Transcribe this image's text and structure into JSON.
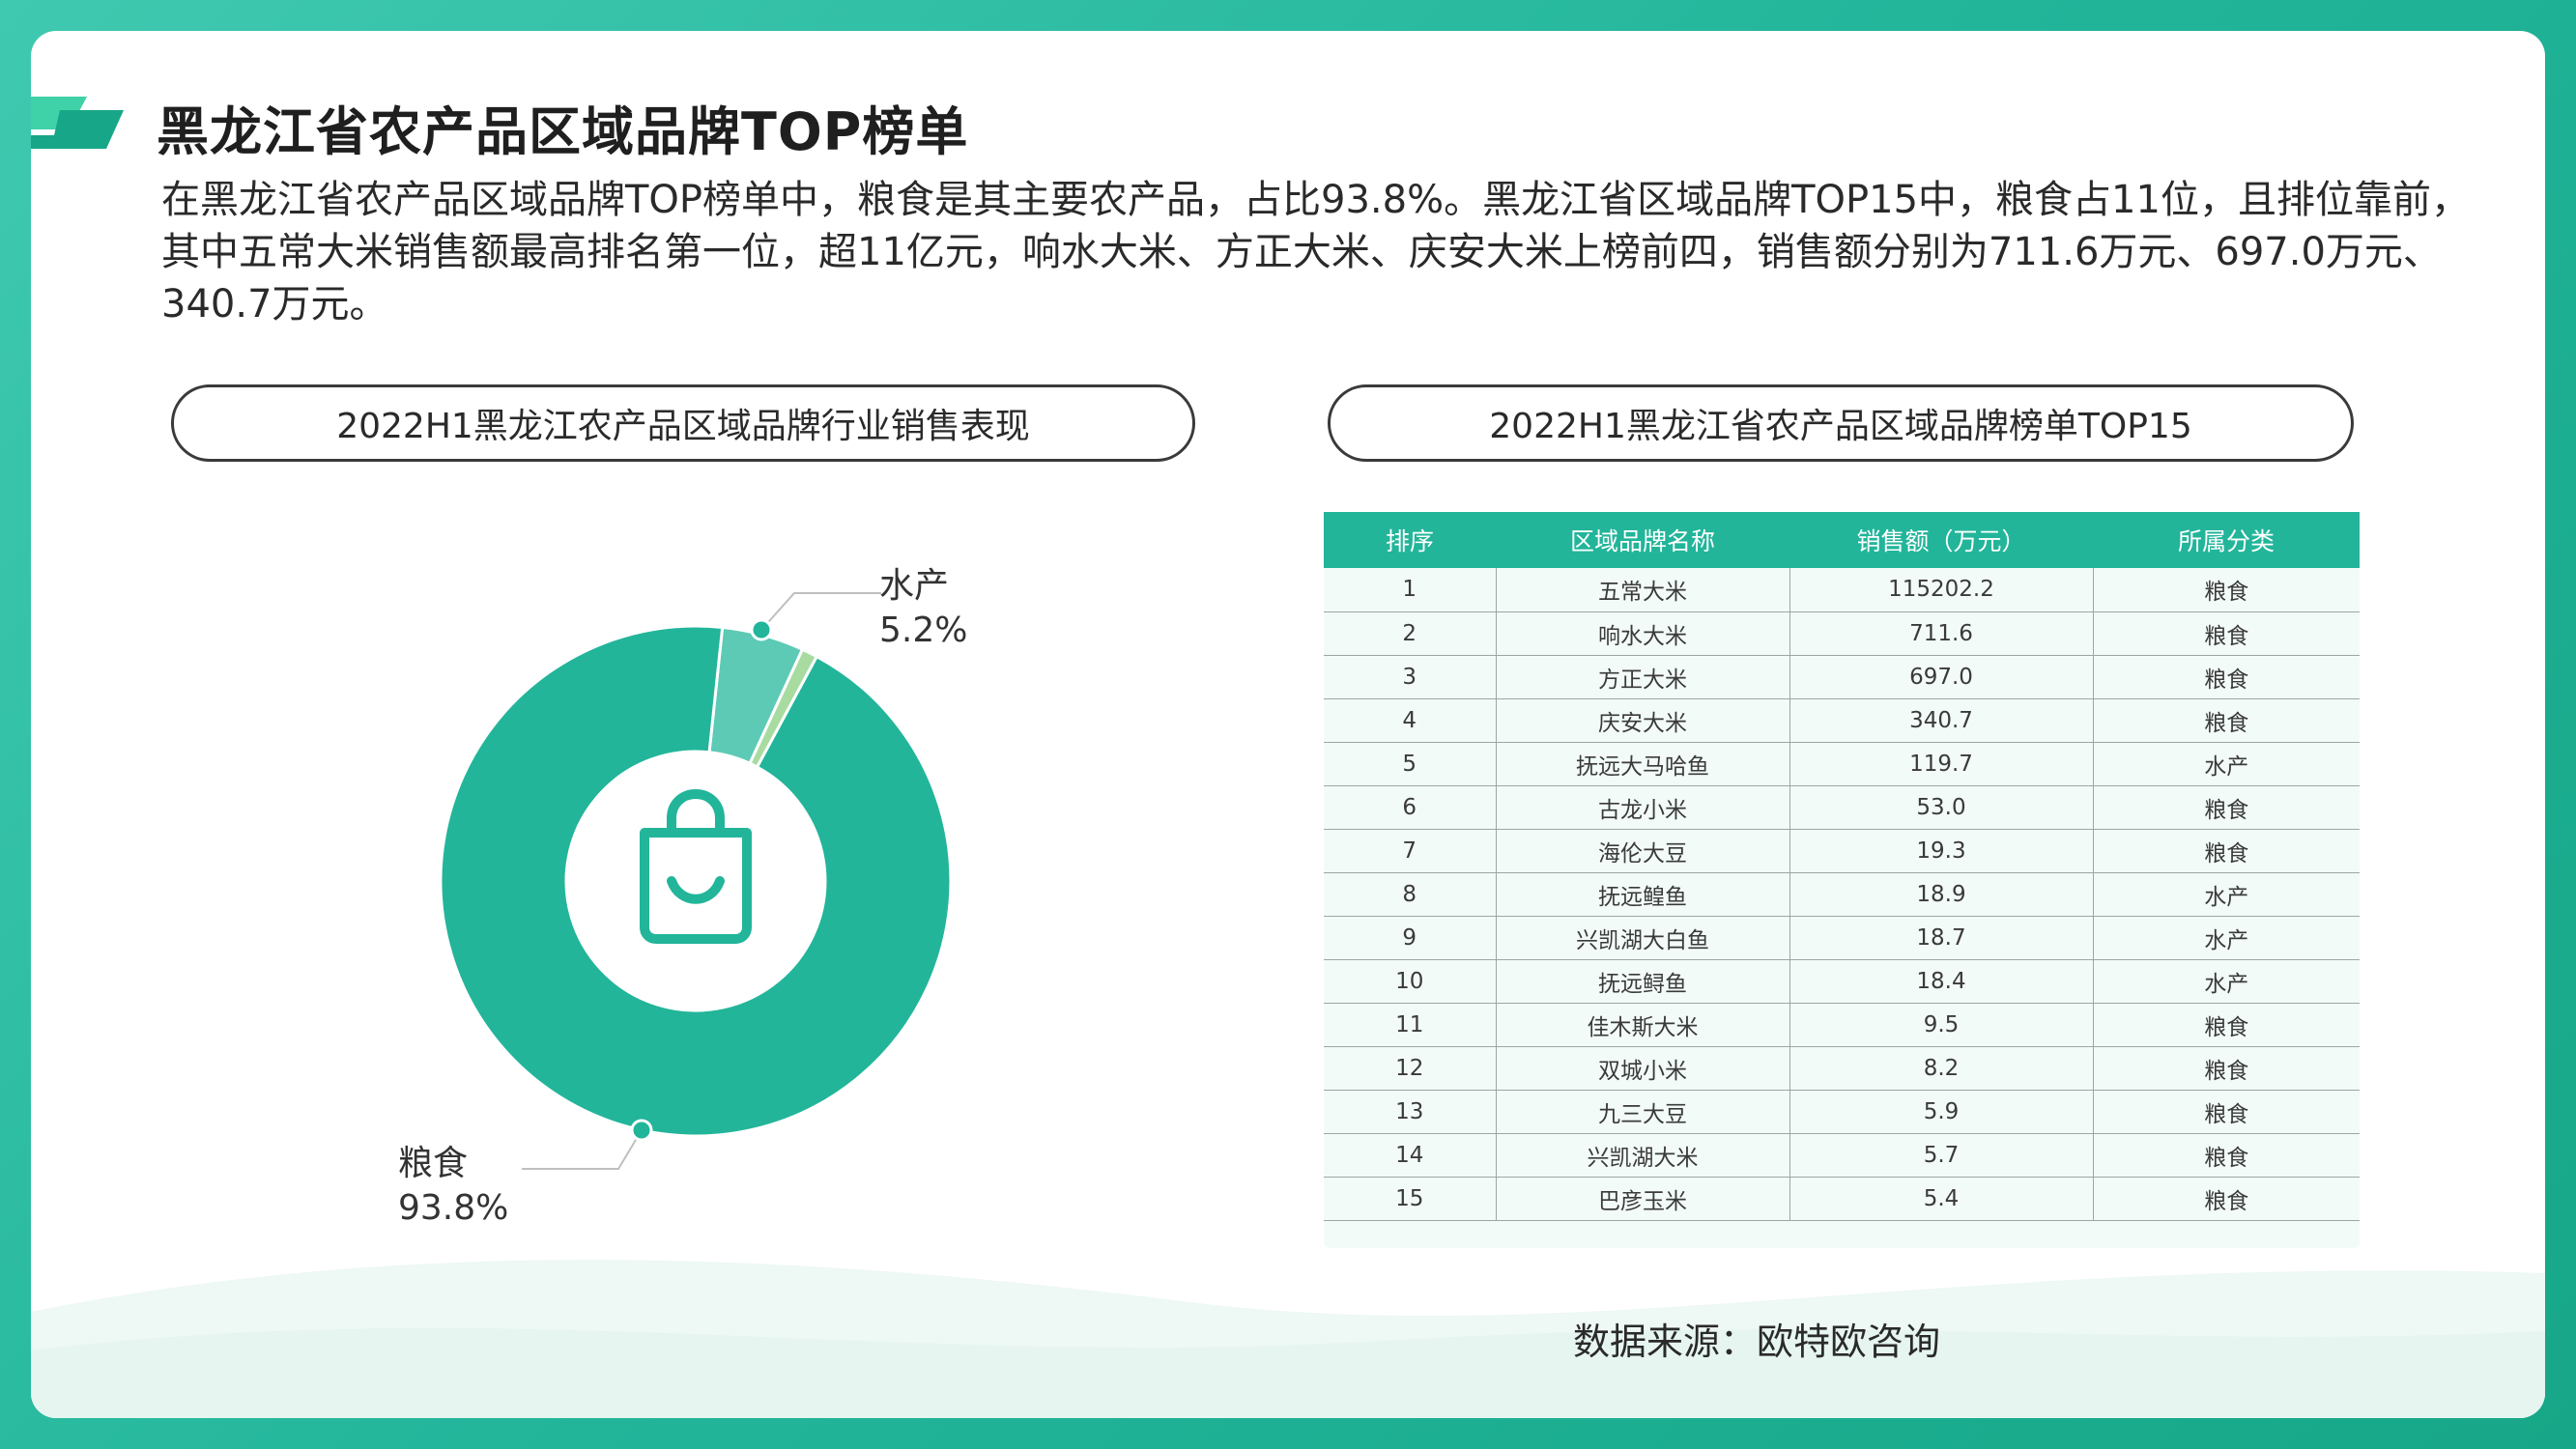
{
  "colors": {
    "accent": "#22b59a",
    "light_accent": "#5ccab5",
    "small_slice": "#a8dba0",
    "table_bg": "#f3fbf8"
  },
  "header": {
    "title": "黑龙江省农产品区域品牌TOP榜单",
    "description": "在黑龙江省农产品区域品牌TOP榜单中，粮食是其主要农产品，占比93.8%。黑龙江省区域品牌TOP15中，粮食占11位，且排位靠前，其中五常大米销售额最高排名第一位，超11亿元，响水大米、方正大米、庆安大米上榜前四，销售额分别为711.6万元、697.0万元、340.7万元。"
  },
  "left_panel": {
    "title": "2022H1黑龙江农产品区域品牌行业销售表现",
    "center_icon": "shopping-bag-icon"
  },
  "right_panel": {
    "title": "2022H1黑龙江省农产品区域品牌榜单TOP15"
  },
  "chart_data": [
    {
      "type": "pie",
      "title": "2022H1黑龙江农产品区域品牌行业销售表现",
      "donut": true,
      "slices": [
        {
          "name": "粮食",
          "value": 93.8,
          "label": "93.8%",
          "color": "#22b59a"
        },
        {
          "name": "水产",
          "value": 5.2,
          "label": "5.2%",
          "color": "#5ccab5"
        },
        {
          "name": "",
          "value": 1.0,
          "label": "",
          "color": "#a8dba0"
        }
      ]
    },
    {
      "type": "table",
      "title": "2022H1黑龙江省农产品区域品牌榜单TOP15",
      "columns": [
        "排序",
        "区域品牌名称",
        "销售额（万元）",
        "所属分类"
      ],
      "rows": [
        [
          "1",
          "五常大米",
          "115202.2",
          "粮食"
        ],
        [
          "2",
          "响水大米",
          "711.6",
          "粮食"
        ],
        [
          "3",
          "方正大米",
          "697.0",
          "粮食"
        ],
        [
          "4",
          "庆安大米",
          "340.7",
          "粮食"
        ],
        [
          "5",
          "抚远大马哈鱼",
          "119.7",
          "水产"
        ],
        [
          "6",
          "古龙小米",
          "53.0",
          "粮食"
        ],
        [
          "7",
          "海伦大豆",
          "19.3",
          "粮食"
        ],
        [
          "8",
          "抚远鳇鱼",
          "18.9",
          "水产"
        ],
        [
          "9",
          "兴凯湖大白鱼",
          "18.7",
          "水产"
        ],
        [
          "10",
          "抚远鲟鱼",
          "18.4",
          "水产"
        ],
        [
          "11",
          "佳木斯大米",
          "9.5",
          "粮食"
        ],
        [
          "12",
          "双城小米",
          "8.2",
          "粮食"
        ],
        [
          "13",
          "九三大豆",
          "5.9",
          "粮食"
        ],
        [
          "14",
          "兴凯湖大米",
          "5.7",
          "粮食"
        ],
        [
          "15",
          "巴彦玉米",
          "5.4",
          "粮食"
        ]
      ]
    }
  ],
  "footer": {
    "source": "数据来源：欧特欧咨询"
  }
}
